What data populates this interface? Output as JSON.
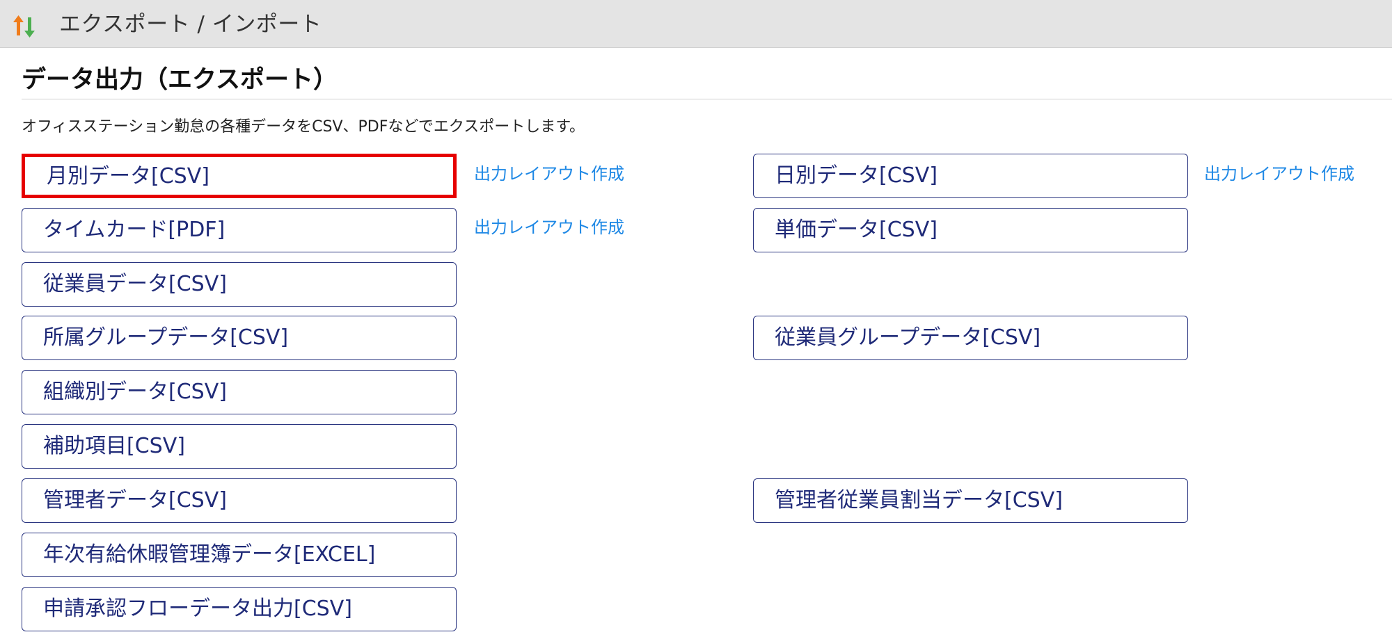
{
  "header": {
    "title": "エクスポート / インポート",
    "icon": "import-export-arrows-icon",
    "colors": {
      "up_arrow": "#f07c1a",
      "down_arrow": "#4caf50"
    }
  },
  "section": {
    "title": "データ出力（エクスポート）",
    "description": "オフィスステーション勤怠の各種データをCSV、PDFなどでエクスポートします。"
  },
  "left_buttons": [
    {
      "label": "月別データ[CSV]",
      "selected": true
    },
    {
      "label": "タイムカード[PDF]"
    },
    {
      "label": "従業員データ[CSV]"
    },
    {
      "label": "所属グループデータ[CSV]"
    },
    {
      "label": "組織別データ[CSV]"
    },
    {
      "label": "補助項目[CSV]"
    },
    {
      "label": "管理者データ[CSV]"
    },
    {
      "label": "年次有給休暇管理簿データ[EXCEL]"
    },
    {
      "label": "申請承認フローデータ出力[CSV]"
    }
  ],
  "right_buttons": [
    {
      "label": "日別データ[CSV]"
    },
    {
      "label": "単価データ[CSV]"
    },
    {
      "label": "従業員グループデータ[CSV]"
    },
    {
      "label": "管理者従業員割当データ[CSV]"
    }
  ],
  "layout_links": [
    {
      "label": "出力レイアウト作成"
    },
    {
      "label": "出力レイアウト作成"
    },
    {
      "label": "出力レイアウト作成"
    }
  ],
  "colors": {
    "button_border": "#2a3580",
    "button_text": "#1f2a78",
    "link": "#1e88e5",
    "highlight": "#e60000",
    "header_bg": "#e4e4e4"
  }
}
